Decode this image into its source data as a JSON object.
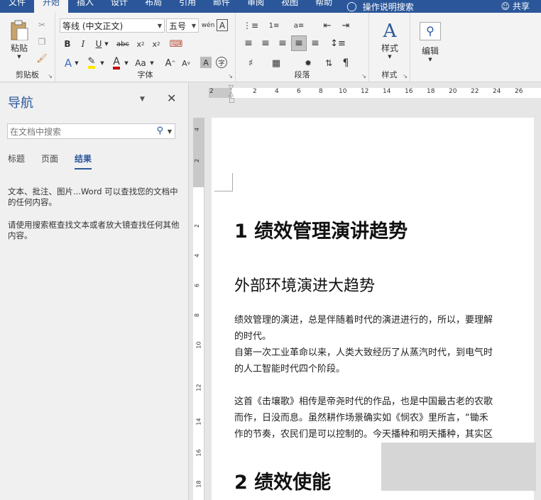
{
  "ribbon_tabs": [
    "文件",
    "开始",
    "插入",
    "设计",
    "布局",
    "引用",
    "邮件",
    "审阅",
    "视图",
    "帮助"
  ],
  "active_tab": "开始",
  "tell_me": "操作说明搜索",
  "share": "共享",
  "clipboard": {
    "paste": "粘贴",
    "label": "剪贴板"
  },
  "font": {
    "name": "等线 (中文正文)",
    "size": "五号",
    "label": "字体"
  },
  "paragraph": {
    "label": "段落"
  },
  "styles": {
    "button": "样式",
    "label": "样式"
  },
  "editing": {
    "button": "编辑"
  },
  "nav": {
    "title": "导航",
    "search_placeholder": "在文档中搜索",
    "tabs": [
      "标题",
      "页面",
      "结果"
    ],
    "active_tab": "结果",
    "msg1": "文本、批注、图片...Word 可以查找您的文档中的任何内容。",
    "msg2": "请使用搜索框查找文本或者放大镜查找任何其他内容。"
  },
  "ruler_ticks": [
    "2",
    "2",
    "4",
    "6",
    "8",
    "10",
    "12",
    "14",
    "16",
    "18",
    "20",
    "22",
    "24",
    "26"
  ],
  "vruler_ticks": [
    "4",
    "2",
    "2",
    "4",
    "6",
    "8",
    "10",
    "12",
    "14",
    "16",
    "18"
  ],
  "doc": {
    "heading1": "1 绩效管理演讲趋势",
    "heading2": "外部环境演进大趋势",
    "p1_l1": "绩效管理的演进，总是伴随着时代的演进进行的，所以，要理解",
    "p1_l2": "的时代。",
    "p2_l1": "自第一次工业革命以来，人类大致经历了从蒸汽时代，到电气时",
    "p2_l2": "的人工智能时代四个阶段。",
    "p3_l1": "这首《击壤歌》相传是帝尧时代的作品，也是中国最古老的农歌",
    "p3_l2": "而作，日没而息。虽然耕作场景确实如《悯农》里所言，“锄禾",
    "p3_l3": "作的节奏，农民们是可以控制的。今天播种和明天播种，其实区",
    "heading1b": "2 绩效使能"
  }
}
